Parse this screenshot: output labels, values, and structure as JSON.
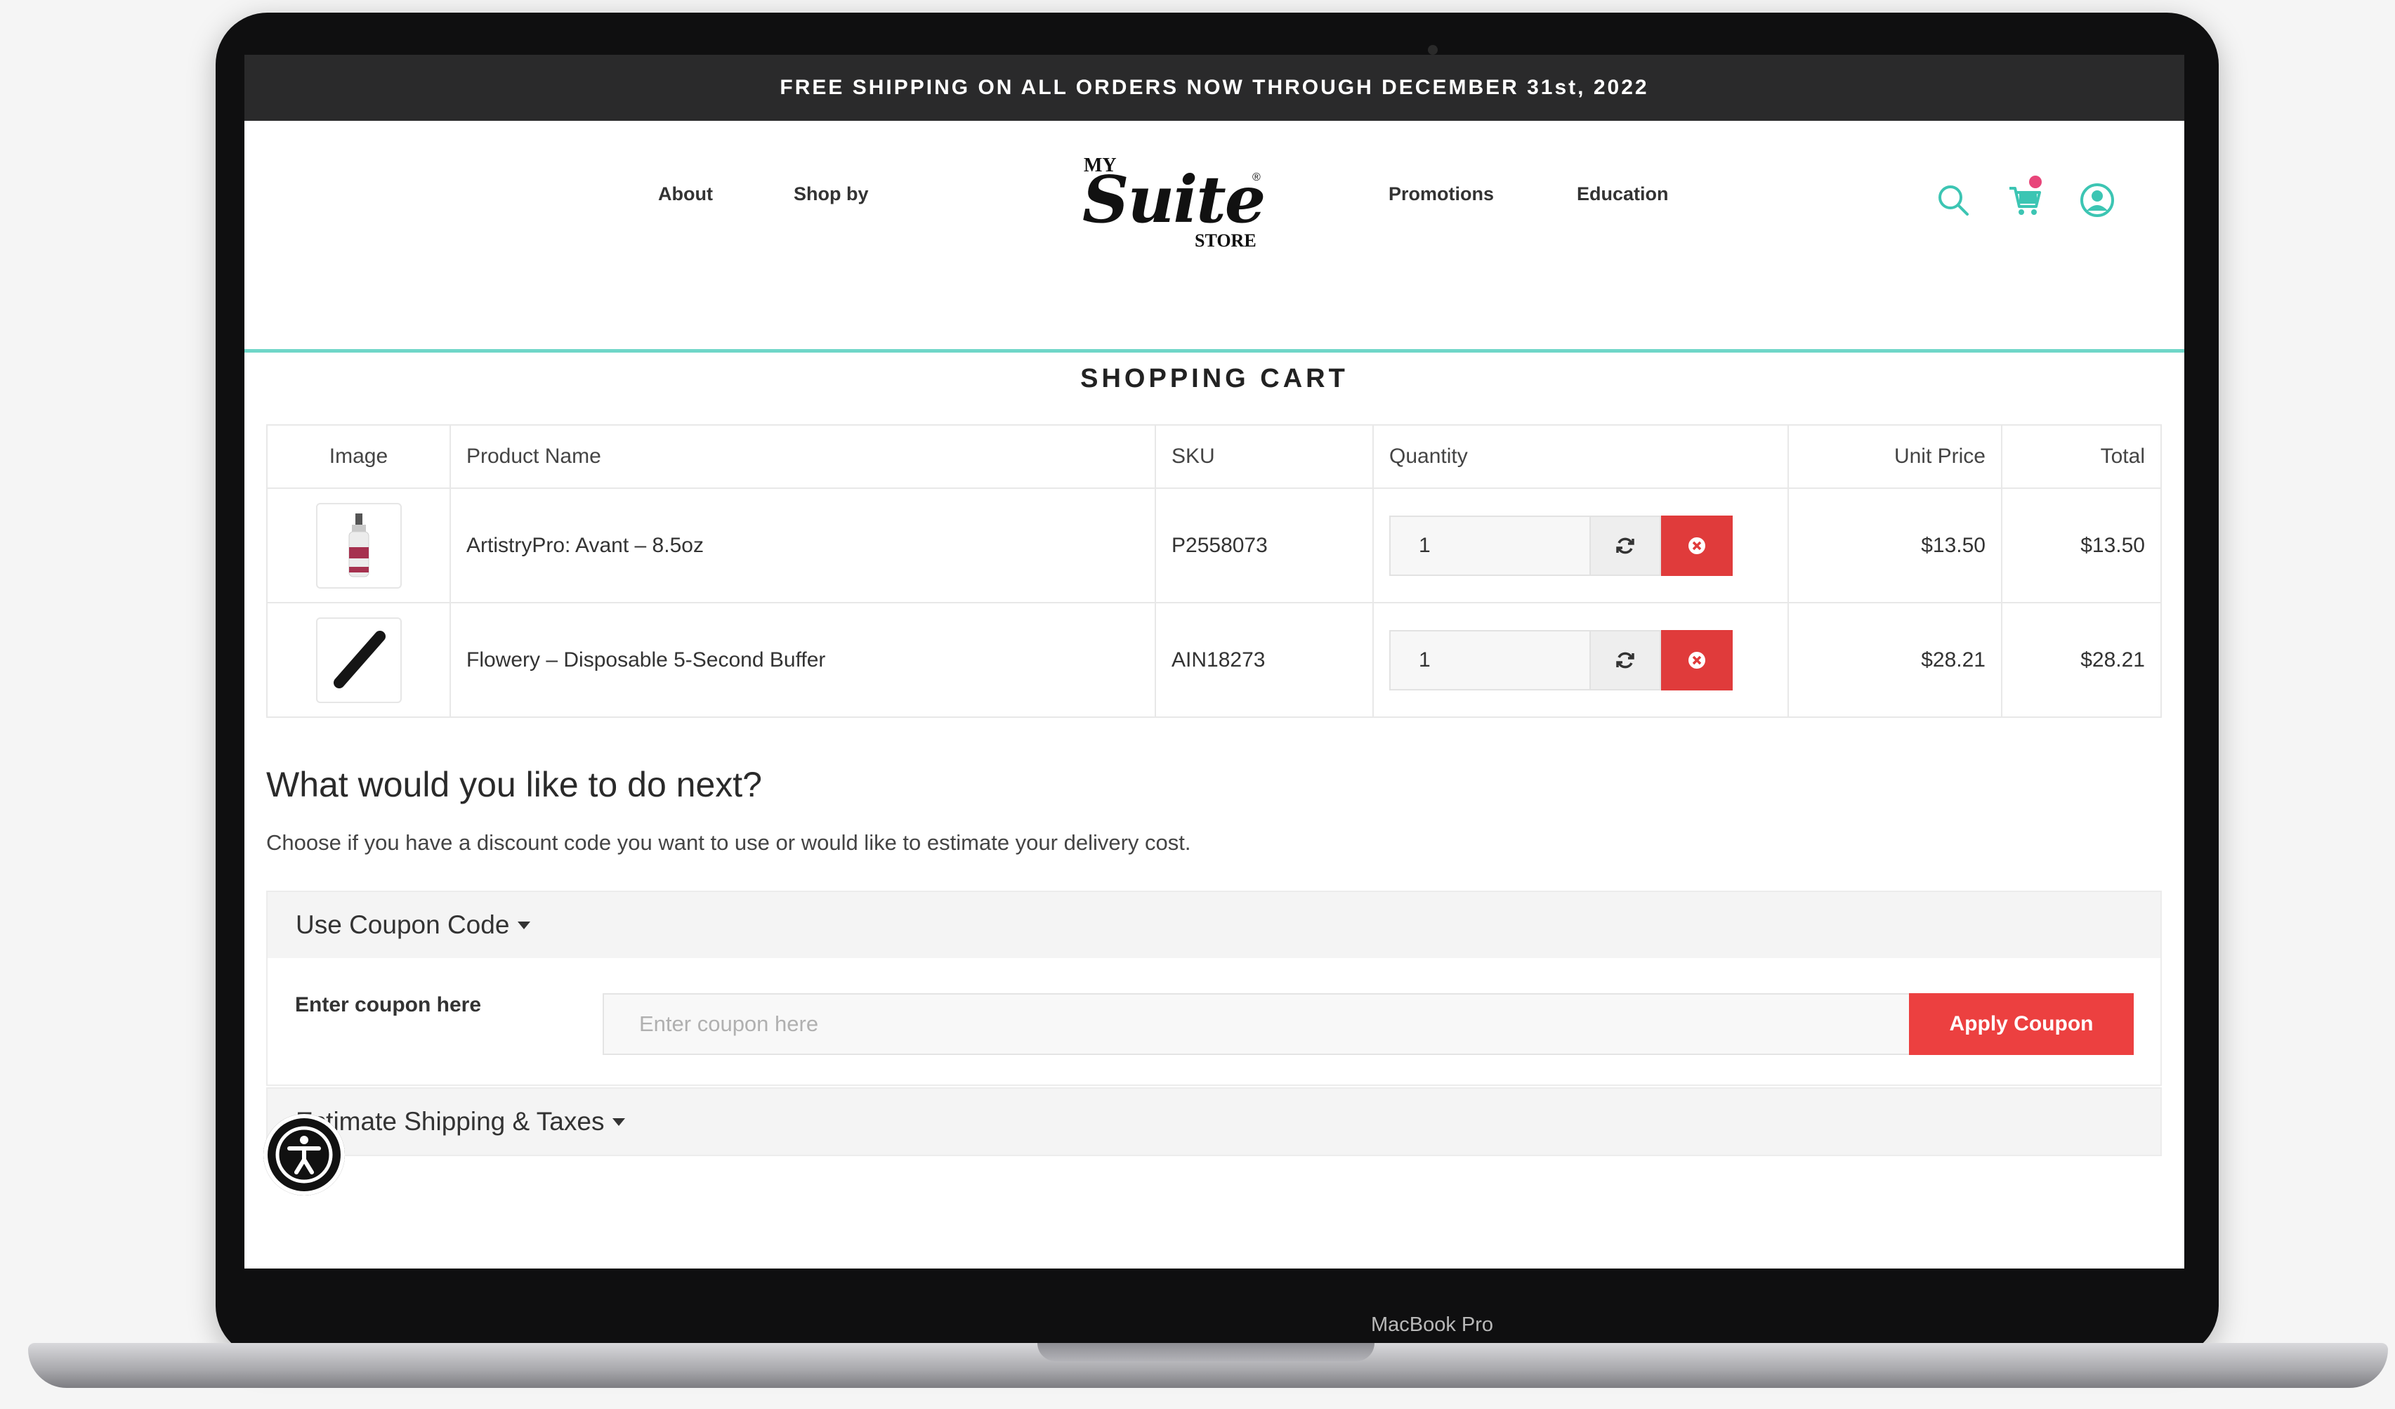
{
  "promo": {
    "text": "FREE SHIPPING ON ALL ORDERS NOW THROUGH DECEMBER 31st, 2022"
  },
  "nav": {
    "about": "About",
    "shop_by": "Shop by",
    "promotions": "Promotions",
    "education": "Education"
  },
  "logo": {
    "my": "MY",
    "suite": "Suite",
    "store": "STORE",
    "reg": "®"
  },
  "header_icons": [
    "search-icon",
    "cart-icon",
    "account-icon"
  ],
  "cart": {
    "title": "SHOPPING CART",
    "columns": {
      "image": "Image",
      "product_name": "Product Name",
      "sku": "SKU",
      "quantity": "Quantity",
      "unit_price": "Unit Price",
      "total": "Total"
    },
    "rows": [
      {
        "name": "ArtistryPro: Avant – 8.5oz",
        "sku": "P2558073",
        "quantity": "1",
        "unit_price": "$13.50",
        "total": "$13.50"
      },
      {
        "name": "Flowery – Disposable 5-Second Buffer",
        "sku": "AIN18273",
        "quantity": "1",
        "unit_price": "$28.21",
        "total": "$28.21"
      }
    ]
  },
  "next": {
    "heading": "What would you like to do next?",
    "description": "Choose if you have a discount code you want to use or would like to estimate your delivery cost."
  },
  "coupon": {
    "toggle_label": "Use Coupon Code",
    "field_label": "Enter coupon here",
    "placeholder": "Enter coupon here",
    "apply_label": "Apply Coupon"
  },
  "shipping": {
    "toggle_label": "Estimate Shipping & Taxes"
  },
  "device": {
    "label": "MacBook Pro"
  },
  "colors": {
    "accent_teal": "#6fd6c8",
    "danger_red": "#e03b3b",
    "promo_bg": "#2a2a2b"
  }
}
